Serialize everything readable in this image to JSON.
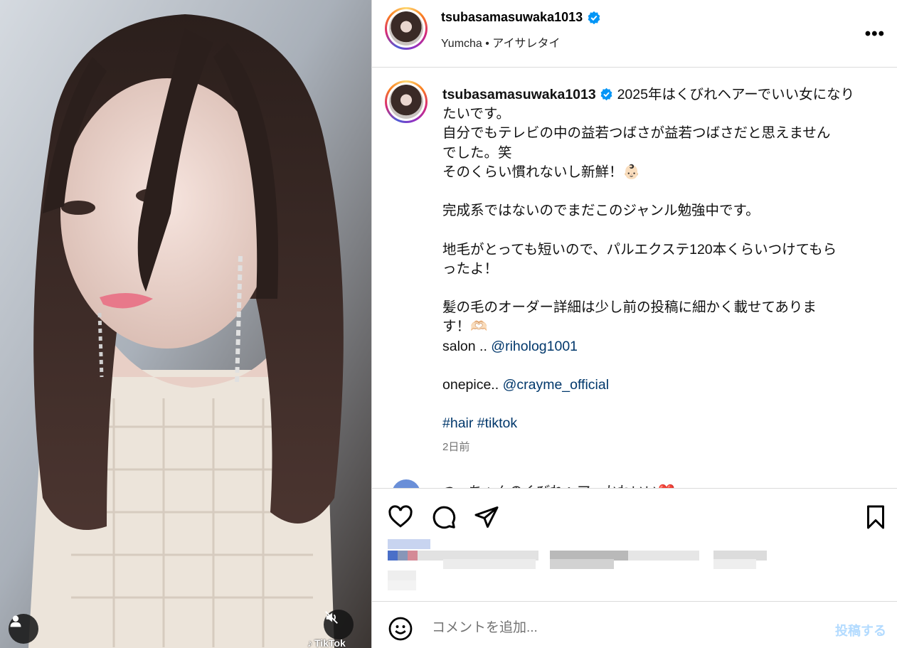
{
  "post": {
    "username": "tsubasamasuwaka1013",
    "subtitle": "Yumcha • アイサレタイ",
    "more_label": "•••",
    "media_watermark": "TikTok"
  },
  "caption": {
    "username": "tsubasamasuwaka1013",
    "line1": "2025年はくびれヘアーでいい女になり",
    "line2": "たいです。",
    "line3": "自分でもテレビの中の益若つばさが益若つばさだと思えません",
    "line4": "でした。笑",
    "line5": "そのくらい慣れないし新鮮！👶🏻",
    "line6": "完成系ではないのでまだこのジャンル勉強中です。",
    "line7": "地毛がとっても短いので、パルエクステ120本くらいつけてもら",
    "line8": "ったよ！",
    "line9": "髪の毛のオーダー詳細は少し前の投稿に細かく載せてありま",
    "line10": "す！🫶🏻",
    "salon_label": "salon ..",
    "salon_link": "@riholog1001",
    "onepice_label": "onepice..",
    "onepice_link": "@crayme_official",
    "tag1": "#hair",
    "tag2": "#tiktok",
    "timestamp": "2日前"
  },
  "peek_comment": {
    "text": "つ　ちゃんのくびれヘア　かわいい❤️"
  },
  "comment_bar": {
    "placeholder": "コメントを追加...",
    "post_label": "投稿する"
  }
}
